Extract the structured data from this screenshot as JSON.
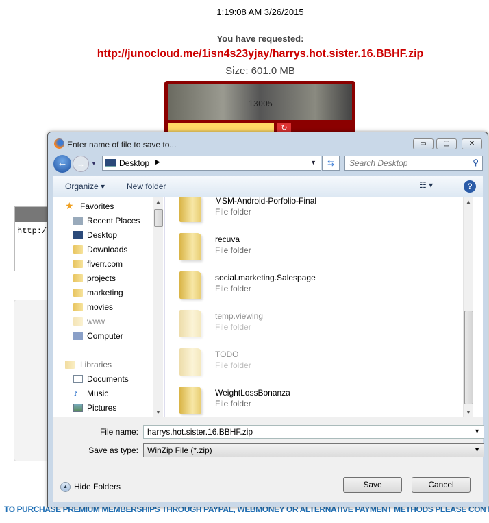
{
  "page": {
    "timestamp": "1:19:08 AM 3/26/2015",
    "requested_label": "You have requested:",
    "file_url": "http://junocloud.me/1isn4s23yjay/harrys.hot.sister.16.BBHF.zip",
    "size": "Size: 601.0 MB",
    "captcha_text": "13005",
    "url_box_text": "http:/",
    "promo": "TO PURCHASE PREMIUM MEMBERSHIPS THROUGH PAYPAL, WEBMONEY OR ALTERNATIVE PAYMENT METHODS PLEASE CONTA"
  },
  "dialog": {
    "title": "Enter name of file to save to...",
    "address": "Desktop",
    "search_placeholder": "Search Desktop",
    "toolbar": {
      "organize": "Organize ▾",
      "new_folder": "New folder"
    },
    "nav": {
      "favorites": "Favorites",
      "items": [
        "Recent Places",
        "Desktop",
        "Downloads",
        "fiverr.com",
        "projects",
        "marketing",
        "movies",
        "www",
        "Computer"
      ],
      "libraries": "Libraries",
      "lib_items": [
        "Documents",
        "Music",
        "Pictures"
      ]
    },
    "files": [
      {
        "name": "MSM-Android-Porfolio-Final",
        "type": "File folder"
      },
      {
        "name": "recuva",
        "type": "File folder"
      },
      {
        "name": "social.marketing.Salespage",
        "type": "File folder"
      },
      {
        "name": "temp.viewing",
        "type": "File folder"
      },
      {
        "name": "TODO",
        "type": "File folder"
      },
      {
        "name": "WeightLossBonanza",
        "type": "File folder"
      }
    ],
    "file_name_label": "File name:",
    "file_name_value": "harrys.hot.sister.16.BBHF.zip",
    "save_type_label": "Save as type:",
    "save_type_value": "WinZip File (*.zip)",
    "hide_folders": "Hide Folders",
    "save": "Save",
    "cancel": "Cancel"
  }
}
